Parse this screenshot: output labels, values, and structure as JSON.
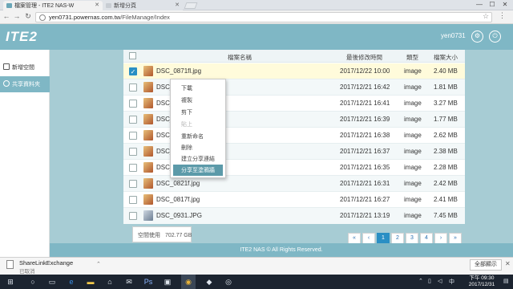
{
  "browser": {
    "tabs": [
      {
        "label": "檔案管理 - ITE2 NAS-W"
      },
      {
        "label": "新增分頁"
      }
    ],
    "url": {
      "host": "yen0731.powernas.com.tw",
      "path": "/FileManage/Index"
    },
    "window_controls": {
      "minimize": "—",
      "maximize": "☐",
      "close": "✕"
    }
  },
  "app": {
    "logo": "ITE2",
    "username": "yen0731"
  },
  "sidebar": {
    "items": [
      {
        "label": "新增空間",
        "active": false
      },
      {
        "label": "共享資料夾",
        "active": true
      }
    ]
  },
  "table": {
    "headers": {
      "name": "檔案名稱",
      "modified": "最後修改時間",
      "type": "類型",
      "size": "檔案大小"
    },
    "rows": [
      {
        "name": "DSC_0871fl.jpg",
        "modified": "2017/12/22 10:00",
        "type": "image",
        "size": "2.40 MB",
        "checked": true
      },
      {
        "name": "DSC_",
        "modified": "2017/12/21 16:42",
        "type": "image",
        "size": "1.81 MB",
        "checked": false
      },
      {
        "name": "DSC_",
        "modified": "2017/12/21 16:41",
        "type": "image",
        "size": "3.27 MB",
        "checked": false
      },
      {
        "name": "DSC_",
        "modified": "2017/12/21 16:39",
        "type": "image",
        "size": "1.77 MB",
        "checked": false
      },
      {
        "name": "DSC_",
        "modified": "2017/12/21 16:38",
        "type": "image",
        "size": "2.62 MB",
        "checked": false
      },
      {
        "name": "DSC_",
        "modified": "2017/12/21 16:37",
        "type": "image",
        "size": "2.38 MB",
        "checked": false
      },
      {
        "name": "DSC_",
        "modified": "2017/12/21 16:35",
        "type": "image",
        "size": "2.28 MB",
        "checked": false
      },
      {
        "name": "DSC_0821f.jpg",
        "modified": "2017/12/21 16:31",
        "type": "image",
        "size": "2.42 MB",
        "checked": false
      },
      {
        "name": "DSC_0817f.jpg",
        "modified": "2017/12/21 16:27",
        "type": "image",
        "size": "2.41 MB",
        "checked": false
      },
      {
        "name": "DSC_0931.JPG",
        "modified": "2017/12/21 13:19",
        "type": "image",
        "size": "7.45 MB",
        "checked": false
      }
    ]
  },
  "context_menu": {
    "items": [
      {
        "label": "下載",
        "state": "normal"
      },
      {
        "label": "複製",
        "state": "normal"
      },
      {
        "label": "剪下",
        "state": "normal"
      },
      {
        "label": "貼上",
        "state": "disabled"
      },
      {
        "label": "重新命名",
        "state": "normal"
      },
      {
        "label": "刪除",
        "state": "normal"
      },
      {
        "label": "建立分享連結",
        "state": "normal"
      },
      {
        "label": "分享至塗鴉牆",
        "state": "highlighted"
      }
    ]
  },
  "storage": {
    "label": "空間使用",
    "value": "702.77 GB"
  },
  "pagination": {
    "first": "«",
    "prev": "‹",
    "pages": [
      "1",
      "2",
      "3",
      "4"
    ],
    "current": "1",
    "next": "›",
    "last": "»"
  },
  "footer": {
    "text": "ITE2 NAS © All Rights Reserved."
  },
  "download": {
    "filename": "ShareLinkExchange",
    "status": "已取消",
    "show_all": "全部顯示",
    "close": "✕"
  },
  "taskbar": {
    "clock_time": "下午 09:30",
    "clock_date": "2017/12/31"
  },
  "colors": {
    "accent": "#7fb7c5",
    "panel": "#a7ccd4",
    "primary": "#2a8fc4",
    "highlight": "#5c9aa9"
  }
}
